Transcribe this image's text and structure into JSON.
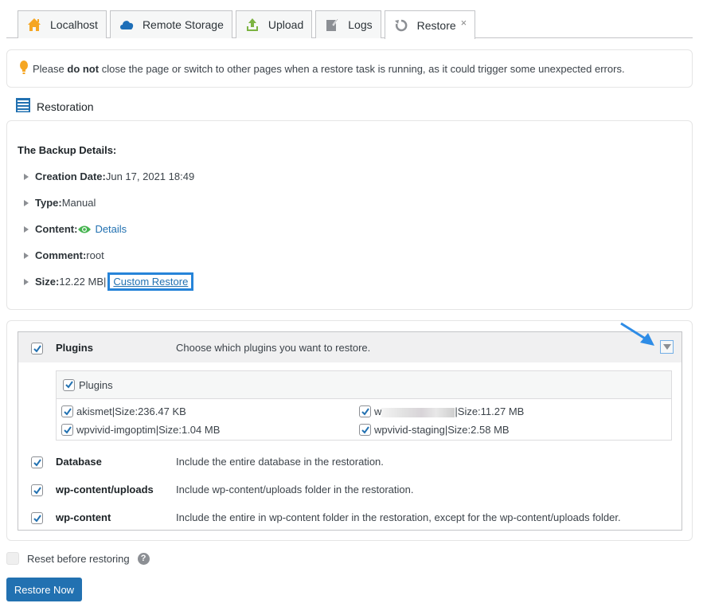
{
  "tabs": [
    {
      "label": "Localhost",
      "icon": "home-icon",
      "active": false
    },
    {
      "label": "Remote Storage",
      "icon": "cloud-icon",
      "active": false
    },
    {
      "label": "Upload",
      "icon": "upload-icon",
      "active": false
    },
    {
      "label": "Logs",
      "icon": "logs-icon",
      "active": false
    },
    {
      "label": "Restore",
      "icon": "restore-icon",
      "active": true,
      "closable": true,
      "close_glyph": "×"
    }
  ],
  "notice": {
    "icon": "lightbulb-icon",
    "prefix": "Please ",
    "bold": "do not",
    "suffix": " close the page or switch to other pages when a restore task is running, as it could trigger some unexpected errors."
  },
  "section": {
    "title": "Restoration",
    "icon": "list-icon"
  },
  "details": {
    "heading": "The Backup Details:",
    "creation_date": {
      "label": "Creation Date:",
      "value": "Jun 17, 2021 18:49"
    },
    "type": {
      "label": "Type:",
      "value": "Manual"
    },
    "content": {
      "label": "Content:",
      "link": "Details",
      "icon": "eye-icon"
    },
    "comment": {
      "label": "Comment:",
      "value": "root"
    },
    "size": {
      "label": "Size:",
      "value": "12.22 MB",
      "separator": " |",
      "link": "Custom Restore"
    }
  },
  "options": {
    "plugins": {
      "name": "Plugins",
      "description": "Choose which plugins you want to restore.",
      "checked": true,
      "table_header": "Plugins",
      "items": [
        {
          "label": "akismet|Size:236.47 KB",
          "checked": true
        },
        {
          "label": "|Size:11.27 MB",
          "checked": true,
          "redacted_prefix": "w"
        },
        {
          "label": "wpvivid-imgoptim|Size:1.04 MB",
          "checked": true
        },
        {
          "label": "wpvivid-staging|Size:2.58 MB",
          "checked": true
        }
      ]
    },
    "database": {
      "name": "Database",
      "description": "Include the entire database in the restoration.",
      "checked": true
    },
    "uploads": {
      "name": "wp-content/uploads",
      "description": "Include wp-content/uploads folder in the restoration.",
      "checked": true
    },
    "wp_content": {
      "name": "wp-content",
      "description": "Include the entire in wp-content folder in the restoration, except for the wp-content/uploads folder.",
      "checked": true
    }
  },
  "reset": {
    "label": "Reset before restoring",
    "checked": false,
    "help_glyph": "?"
  },
  "restore_button": "Restore Now",
  "colors": {
    "accent": "#2271b1",
    "highlight": "#2684d9",
    "eye": "#46b450",
    "bulb": "#f5a623"
  }
}
